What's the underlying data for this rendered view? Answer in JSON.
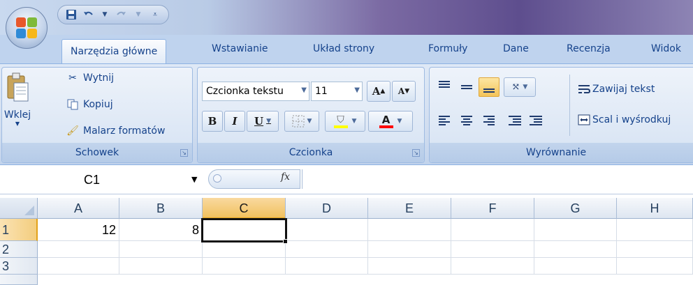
{
  "qat": {
    "save_icon": "save-icon",
    "undo_icon": "undo-icon",
    "redo_icon": "redo-icon",
    "customize_icon": "customize-icon"
  },
  "tabs": [
    "Narzędzia główne",
    "Wstawianie",
    "Układ strony",
    "Formuły",
    "Dane",
    "Recenzja",
    "Widok"
  ],
  "clipboard": {
    "paste_label": "Wklej",
    "cut_label": "Wytnij",
    "copy_label": "Kopiuj",
    "format_painter_label": "Malarz formatów",
    "group_label": "Schowek"
  },
  "font": {
    "font_name": "Czcionka tekstu",
    "font_size": "11",
    "grow_label": "A",
    "shrink_label": "A",
    "bold_label": "B",
    "italic_label": "I",
    "underline_label": "U",
    "color_label": "A",
    "group_label": "Czcionka"
  },
  "alignment": {
    "wrap_label": "Zawijaj tekst",
    "merge_label": "Scal i wyśrodkuj",
    "group_label": "Wyrównanie"
  },
  "formula_bar": {
    "name_box": "C1",
    "fx_label": "fx",
    "formula": ""
  },
  "grid": {
    "columns": [
      "A",
      "B",
      "C",
      "D",
      "E",
      "F",
      "G",
      "H"
    ],
    "rows": [
      "1",
      "2",
      "3"
    ],
    "cells": {
      "A1": "12",
      "B1": "8",
      "C1": ""
    },
    "selected_cell": "C1",
    "selection_color": "#f1c15f"
  }
}
